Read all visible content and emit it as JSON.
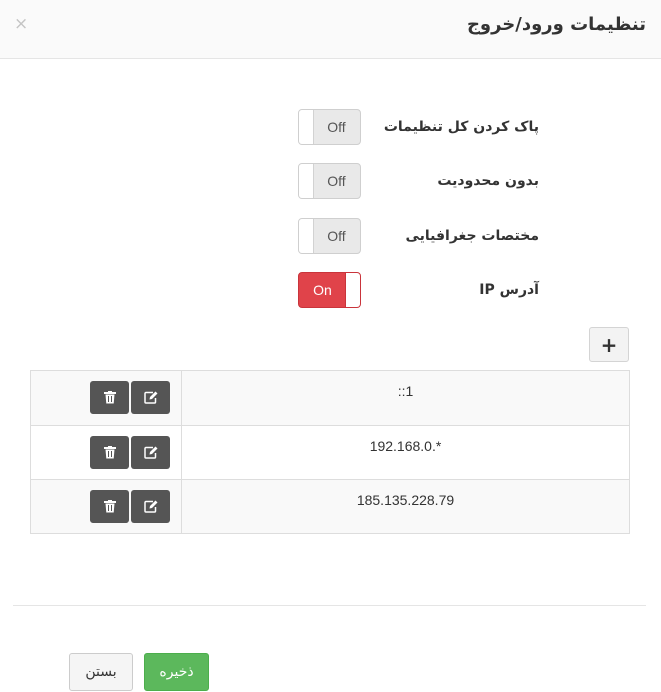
{
  "dialog": {
    "title": "تنظیمات ورود/خروج",
    "close_glyph": "×"
  },
  "settings": [
    {
      "label": "پاک کردن کل تنظیمات",
      "state": "Off"
    },
    {
      "label": "بدون محدودیت",
      "state": "Off"
    },
    {
      "label": "مختصات جغرافیایی",
      "state": "Off"
    },
    {
      "label": "آدرس IP",
      "state": "On"
    }
  ],
  "colors": {
    "toggle_on": "#e0434a",
    "save_button": "#5cb85c",
    "action_button": "#555555"
  },
  "ip_list": {
    "add_label": "+",
    "rows": [
      {
        "ip": "::1"
      },
      {
        "ip": "192.168.0.*"
      },
      {
        "ip": "185.135.228.79"
      }
    ]
  },
  "footer": {
    "save_label": "ذخیره",
    "close_label": "بستن"
  }
}
